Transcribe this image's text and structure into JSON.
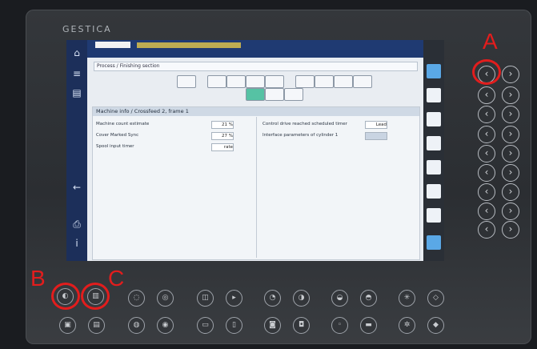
{
  "device": {
    "brand": "GESTICA"
  },
  "screen": {
    "breadcrumb": "Process / Finishing section",
    "panel_title": "Machine info / Crossfeed 2, frame 1",
    "left_fields": [
      {
        "label": "Machine count estimate",
        "value": "21 %"
      },
      {
        "label": "Cover Marked Sync",
        "value": "27 %"
      },
      {
        "label": "Spool input timer",
        "value": "rate"
      }
    ],
    "right_fields": [
      {
        "label": "Control drive reached scheduled timer",
        "value": "Lead"
      },
      {
        "label": "Interface parameters of cylinder 1",
        "value": ""
      }
    ]
  },
  "annotations": {
    "a": "A",
    "b": "B",
    "c": "C"
  },
  "colors": {
    "annotation": "#e21d1d",
    "screen_blue": "#1f3a72",
    "accent_green": "#56c2a4",
    "bezel": "#2b2e32"
  }
}
